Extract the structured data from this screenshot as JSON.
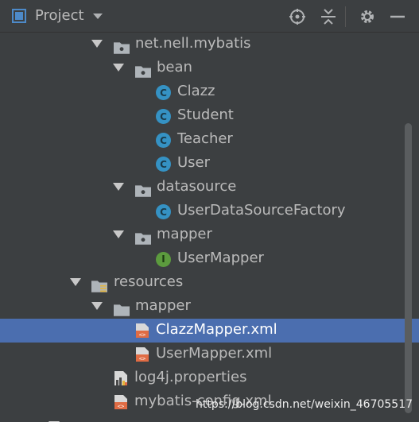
{
  "header": {
    "title": "Project",
    "icons": [
      "project-view-icon",
      "dropdown-arrow-icon",
      "locate-icon",
      "collapse-all-icon",
      "settings-gear-icon",
      "hide-minimize-icon"
    ]
  },
  "tree": {
    "items": [
      {
        "label": "net.nell.mybatis",
        "type": "package",
        "expanded": true
      },
      {
        "label": "bean",
        "type": "package",
        "expanded": true
      },
      {
        "label": "Clazz",
        "type": "class",
        "badge": "C"
      },
      {
        "label": "Student",
        "type": "class",
        "badge": "C"
      },
      {
        "label": "Teacher",
        "type": "class",
        "badge": "C"
      },
      {
        "label": "User",
        "type": "class",
        "badge": "C"
      },
      {
        "label": "datasource",
        "type": "package",
        "expanded": true
      },
      {
        "label": "UserDataSourceFactory",
        "type": "class",
        "badge": "C"
      },
      {
        "label": "mapper",
        "type": "package",
        "expanded": true
      },
      {
        "label": "UserMapper",
        "type": "interface",
        "badge": "I"
      },
      {
        "label": "resources",
        "type": "resources-folder",
        "expanded": true
      },
      {
        "label": "mapper",
        "type": "folder",
        "expanded": true
      },
      {
        "label": "ClazzMapper.xml",
        "type": "xml-file",
        "selected": true
      },
      {
        "label": "UserMapper.xml",
        "type": "xml-file"
      },
      {
        "label": "log4j.properties",
        "type": "properties-file"
      },
      {
        "label": "mybatis-config.xml",
        "type": "xml-file"
      }
    ]
  },
  "colors": {
    "background": "#3c3f41",
    "selection": "#4b6eaf",
    "text": "#bbbbbb",
    "class_badge": "#3592c4",
    "interface_badge": "#5c9b3e",
    "xml_icon": "#e06c44"
  },
  "watermark": "https://blog.csdn.net/weixin_46705517"
}
